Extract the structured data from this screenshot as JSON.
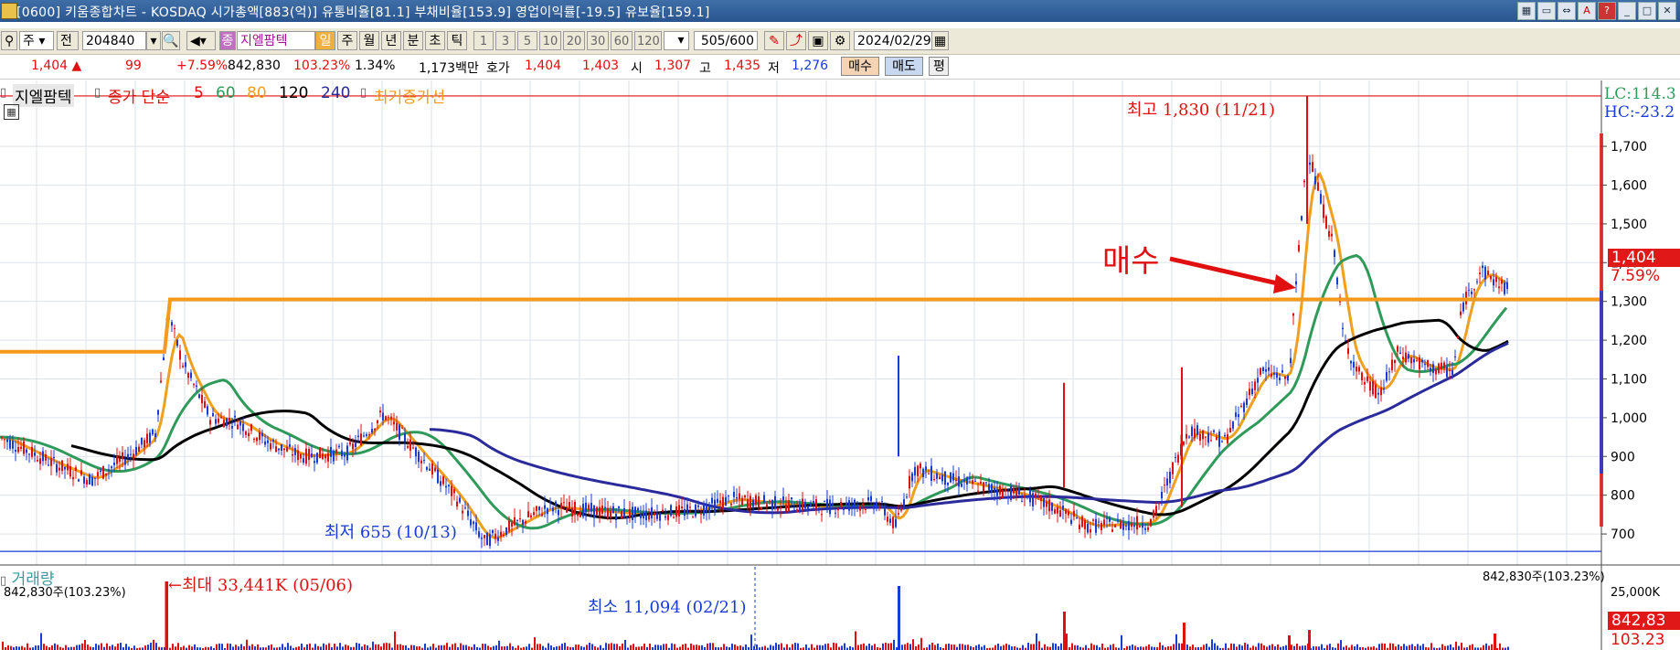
{
  "window": {
    "title": "[0600] 키움종합차트 - KOSDAQ 시가총액[883(억)] 유통비율[81.1] 부채비율[153.9] 영업이익률[-19.5] 유보율[159.1]"
  },
  "toolbar": {
    "market_select": "주",
    "prev_button": "전",
    "code_value": "204840",
    "stock_name": "지엘팜텍",
    "period_tabs": [
      "일",
      "주",
      "월",
      "년",
      "분",
      "초",
      "틱"
    ],
    "active_period": "일",
    "interval_buttons": [
      "1",
      "3",
      "5",
      "10",
      "20",
      "30",
      "60",
      "120"
    ],
    "count_value": "505",
    "count_max": "/600",
    "date_value": "2024/02/29"
  },
  "quote": {
    "price": "1,404",
    "change": "99",
    "change_pct": "+7.59%",
    "volume": "842,830",
    "vol_ratio": "103.23%",
    "turnover": "1.34%",
    "amount": "1,173백만",
    "bid_label": "호가",
    "ask_price": "1,404",
    "bid_price": "1,403",
    "open_label": "시",
    "open": "1,307",
    "high_label": "고",
    "high": "1,435",
    "low_label": "저",
    "low": "1,276",
    "buy_button": "매수",
    "sell_button": "매도",
    "eval_button": "평"
  },
  "legend": {
    "name": "지엘팜텍",
    "close_label": "종가 단순",
    "ma5": "5",
    "ma60": "60",
    "ma80": "80",
    "ma120": "120",
    "ma240": "240",
    "max_volume_line": "최거종가선"
  },
  "colors": {
    "up": "#e01010",
    "down": "#1a3bd8",
    "ma5": "#e01010",
    "ma60": "#2f9a5a",
    "ma80": "#f0a020",
    "ma120": "#000000",
    "ma240": "#2a2a9a",
    "hline": "#f59a1a"
  },
  "annotations": {
    "high": "최고 1,830 (11/21)",
    "low": "최저 655 (10/13)",
    "buy": "매수",
    "vol_max": "최대 33,441K (05/06)",
    "vol_min": "최소 11,094 (02/21)",
    "lc": "LC:114.3",
    "hc": "HC:-23.2",
    "current_price": "1,404",
    "current_pct": "7.59%",
    "vol_right": "842,830주(103.23%)",
    "vol_left": "842,830주(103.23%)",
    "vol_box": "842,83",
    "vol_box2": "103.23"
  },
  "volume_panel": {
    "title": "거래량",
    "axis_label": "25,000K"
  },
  "chart_data": {
    "type": "candlestick",
    "price_axis_ticks": [
      700,
      800,
      900,
      1000,
      1100,
      1200,
      1300,
      1400,
      1500,
      1600,
      1700
    ],
    "ylim": [
      620,
      1870
    ],
    "reference_line": 1305,
    "high_line": 1830,
    "low_line": 655,
    "ma_series": [
      {
        "name": "5",
        "color": "#e01010"
      },
      {
        "name": "60",
        "color": "#2f9a5a"
      },
      {
        "name": "80",
        "color": "#f0a020"
      },
      {
        "name": "120",
        "color": "#000000"
      },
      {
        "name": "240",
        "color": "#2a2a9a"
      }
    ]
  }
}
